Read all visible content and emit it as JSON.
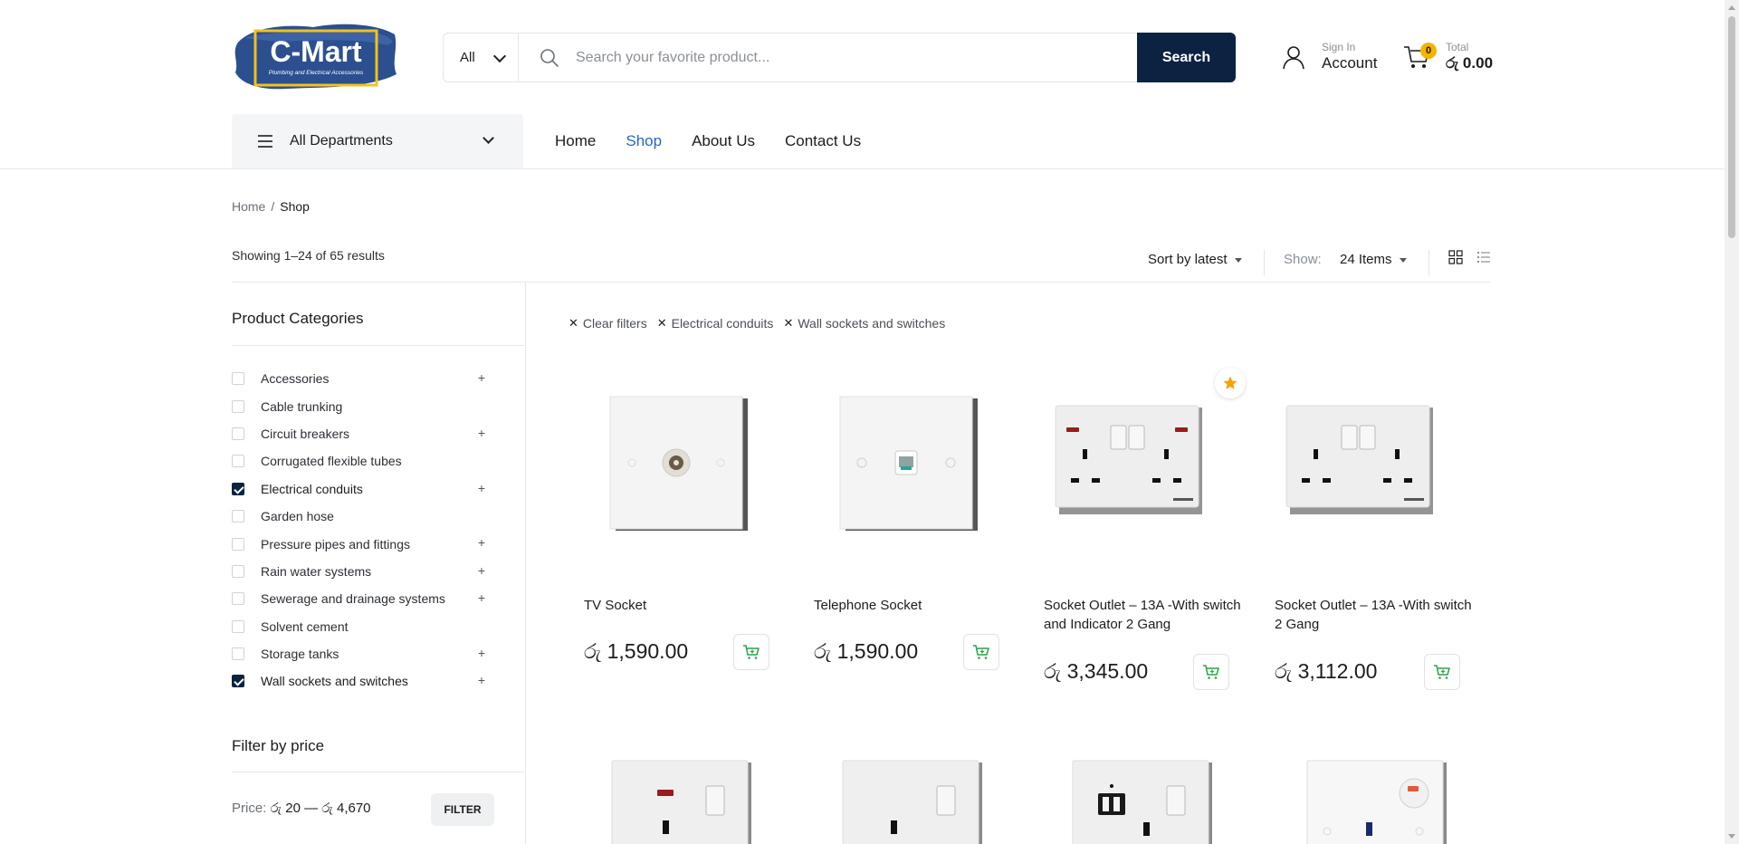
{
  "brand": {
    "logo_text": "C-Mart",
    "logo_tagline": "Plumbing and Electrical Accessories"
  },
  "search": {
    "category": "All",
    "placeholder": "Search your favorite product...",
    "button_label": "Search"
  },
  "account": {
    "small": "Sign In",
    "big": "Account"
  },
  "cart": {
    "count": "0",
    "small": "Total",
    "total": "රු 0.00"
  },
  "departments": {
    "label": "All Departments"
  },
  "nav": [
    {
      "label": "Home"
    },
    {
      "label": "Shop"
    },
    {
      "label": "About Us"
    },
    {
      "label": "Contact Us"
    }
  ],
  "breadcrumb": {
    "home": "Home",
    "separator": "/",
    "current": "Shop"
  },
  "results_text": "Showing 1–24 of 65 results",
  "toolbar": {
    "sort_label": "Sort by latest",
    "show_label": "Show:",
    "show_value": "24 Items"
  },
  "sidebar": {
    "categories_title": "Product Categories",
    "categories": [
      {
        "label": "Accessories",
        "checked": false,
        "expandable": true
      },
      {
        "label": "Cable trunking",
        "checked": false,
        "expandable": false
      },
      {
        "label": "Circuit breakers",
        "checked": false,
        "expandable": true
      },
      {
        "label": "Corrugated flexible tubes",
        "checked": false,
        "expandable": false
      },
      {
        "label": "Electrical conduits",
        "checked": true,
        "expandable": true
      },
      {
        "label": "Garden hose",
        "checked": false,
        "expandable": false
      },
      {
        "label": "Pressure pipes and fittings",
        "checked": false,
        "expandable": true
      },
      {
        "label": "Rain water systems",
        "checked": false,
        "expandable": true
      },
      {
        "label": "Sewerage and drainage systems",
        "checked": false,
        "expandable": true
      },
      {
        "label": "Solvent cement",
        "checked": false,
        "expandable": false
      },
      {
        "label": "Storage tanks",
        "checked": false,
        "expandable": true
      },
      {
        "label": "Wall sockets and switches",
        "checked": true,
        "expandable": true
      }
    ],
    "price_title": "Filter by price",
    "price_label": "Price:",
    "price_min": "රු 20",
    "price_sep": "—",
    "price_max": "රු 4,670",
    "filter_button": "FILTER"
  },
  "active_filters": [
    {
      "label": "Clear filters"
    },
    {
      "label": "Electrical conduits"
    },
    {
      "label": "Wall sockets and switches"
    }
  ],
  "products": [
    {
      "name": "TV Socket",
      "price": "රු 1,590.00"
    },
    {
      "name": "Telephone Socket",
      "price": "රු 1,590.00"
    },
    {
      "name": "Socket Outlet – 13A -With switch and Indicator 2 Gang",
      "price": "රු 3,345.00",
      "featured": true
    },
    {
      "name": "Socket Outlet – 13A -With switch 2 Gang",
      "price": "රු 3,112.00"
    }
  ],
  "plus_symbol": "+",
  "remove_symbol": "✕",
  "colors": {
    "primary": "#0b2340",
    "accent": "#2764c8",
    "cart_green": "#2aa34a",
    "badge": "#f5b400"
  }
}
